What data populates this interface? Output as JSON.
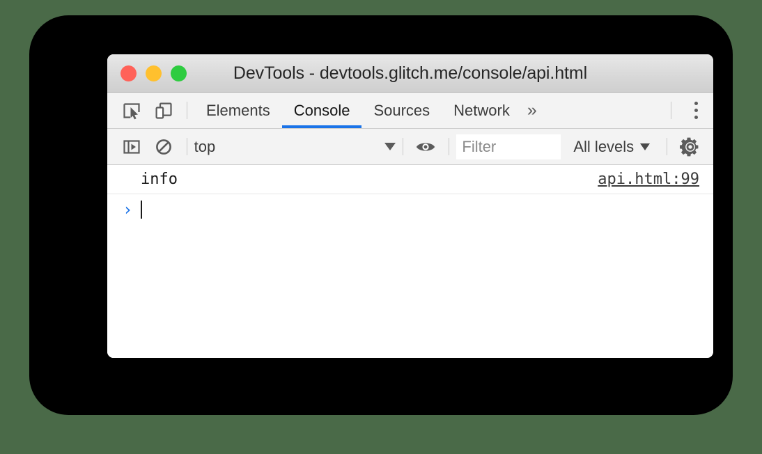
{
  "window": {
    "title": "DevTools - devtools.glitch.me/console/api.html",
    "traffic_lights": [
      {
        "name": "close",
        "color": "#ff6259"
      },
      {
        "name": "minimize",
        "color": "#ffc02e"
      },
      {
        "name": "maximize",
        "color": "#2ecc40"
      }
    ]
  },
  "tabbar": {
    "inspect_icon": "inspect-element-icon",
    "device_icon": "device-toolbar-icon",
    "tabs": [
      {
        "label": "Elements",
        "active": false
      },
      {
        "label": "Console",
        "active": true
      },
      {
        "label": "Sources",
        "active": false
      },
      {
        "label": "Network",
        "active": false
      }
    ],
    "overflow_label": "»",
    "menu_icon": "kebab-menu-icon",
    "active_tab_color": "#1a73e8"
  },
  "console_toolbar": {
    "sidebar_toggle_icon": "console-sidebar-toggle-icon",
    "clear_icon": "clear-console-icon",
    "context": {
      "value": "top"
    },
    "eye_icon": "live-expression-eye-icon",
    "filter": {
      "value": "",
      "placeholder": "Filter"
    },
    "level": {
      "value": "All levels"
    },
    "settings_icon": "settings-gear-icon"
  },
  "console": {
    "messages": [
      {
        "text": "info",
        "source": "api.html:99"
      }
    ],
    "prompt": {
      "chevron": "›",
      "input_value": ""
    }
  },
  "theme": {
    "page_background": "#4a6a48",
    "frame_color": "#000000",
    "window_background": "#ffffff",
    "toolbar_background": "#f3f3f3",
    "accent": "#1a73e8"
  }
}
